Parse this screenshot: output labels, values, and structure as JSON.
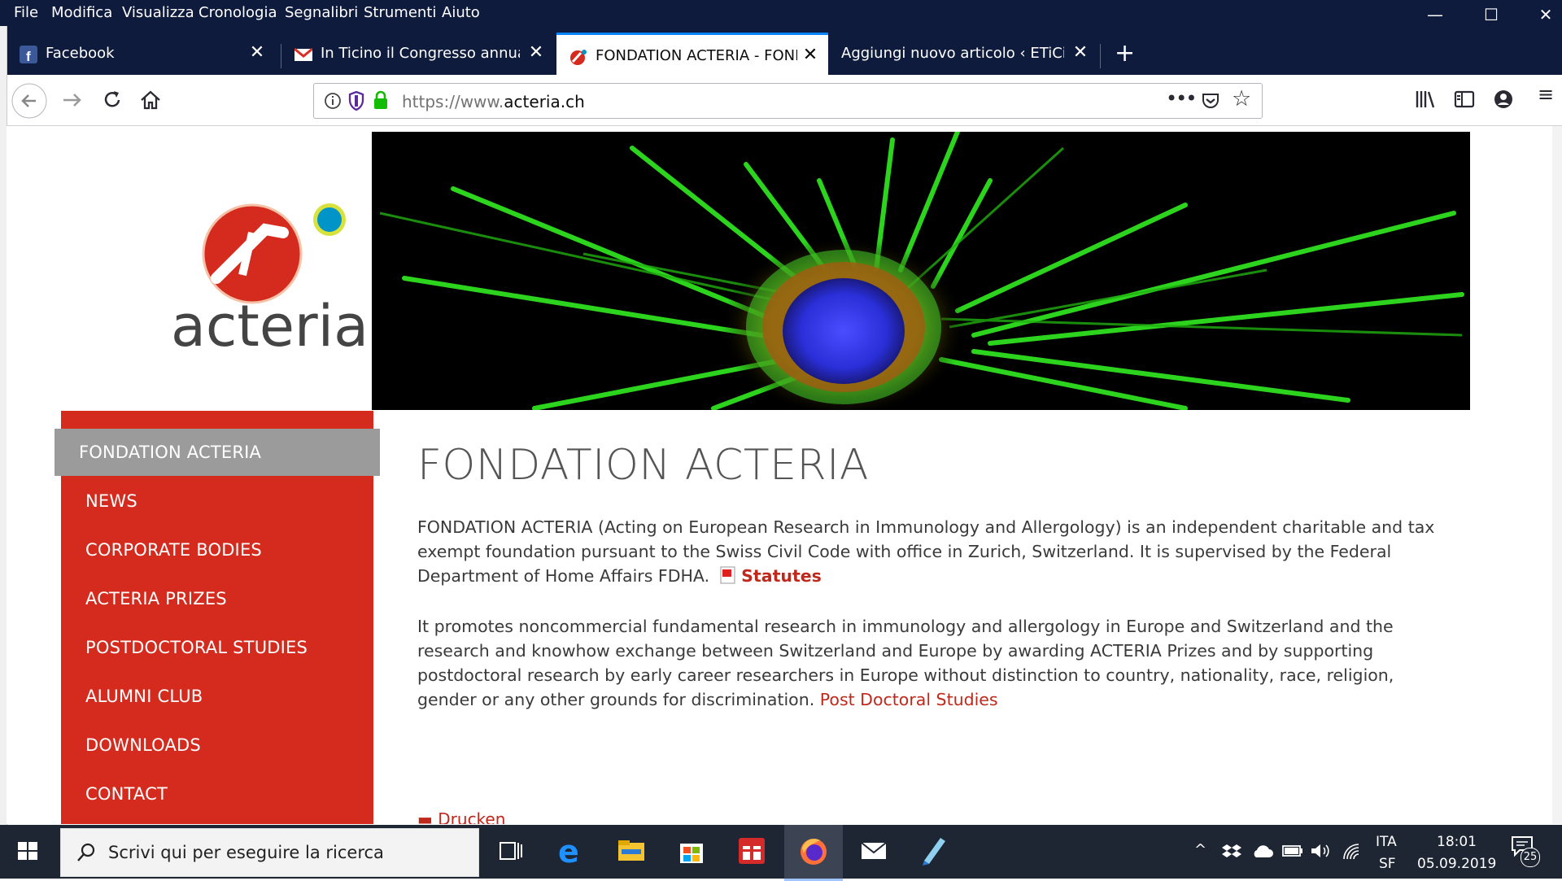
{
  "menu": [
    "File",
    "Modifica",
    "Visualizza",
    "Cronologia",
    "Segnalibri",
    "Strumenti",
    "Aiuto"
  ],
  "tabs": [
    {
      "label": "Facebook",
      "icon": "facebook-icon"
    },
    {
      "label": "In Ticino il Congresso annuale d",
      "icon": "gmail-icon"
    },
    {
      "label": "FONDATION ACTERIA - FONDA",
      "icon": "acteria-favicon",
      "active": true
    },
    {
      "label": "Aggiungi nuovo articolo ‹ ETiCinfor",
      "icon": "wordpress-icon"
    }
  ],
  "urlbar": {
    "prefix": "https://www.",
    "domain": "acteria.ch"
  },
  "logo": {
    "text": "acteria"
  },
  "sidebar": {
    "items": [
      {
        "label": "FONDATION ACTERIA",
        "active": true
      },
      {
        "label": "NEWS"
      },
      {
        "label": "CORPORATE BODIES"
      },
      {
        "label": "ACTERIA PRIZES"
      },
      {
        "label": "POSTDOCTORAL STUDIES"
      },
      {
        "label": "ALUMNI CLUB"
      },
      {
        "label": "DOWNLOADS"
      },
      {
        "label": "CONTACT"
      }
    ]
  },
  "main": {
    "title": "FONDATION ACTERIA",
    "para1": "FONDATION ACTERIA (Acting on European Research in Immunology and Allergology) is an independent charitable and tax exempt foundation pursuant to the Swiss Civil Code with office in Zurich, Switzerland. It is supervised by the Federal Department of Home Affairs FDHA.",
    "statutes_link": "Statutes",
    "para2": "It promotes noncommercial fundamental research in immunology and allergology in Europe and Switzerland and the research and knowhow exchange between Switzerland and Europe by awarding ACTERIA Prizes and by supporting postdoctoral research by early career researchers in Europe without distinction to country, nationality, race, religion, gender or any other grounds for discrimination.",
    "postdoc_link": "Post Doctoral Studies",
    "print_link": "Drucken"
  },
  "taskbar": {
    "search_placeholder": "Scrivi qui per eseguire la ricerca",
    "lang_top": "ITA",
    "lang_bottom": "SF",
    "time": "18:01",
    "date": "05.09.2019",
    "notification_count": "25"
  },
  "colors": {
    "brand_red": "#d52b1e",
    "nav_active": "#9b9b9b",
    "titlebar": "#0f1b3d",
    "link": "#c0281b"
  }
}
